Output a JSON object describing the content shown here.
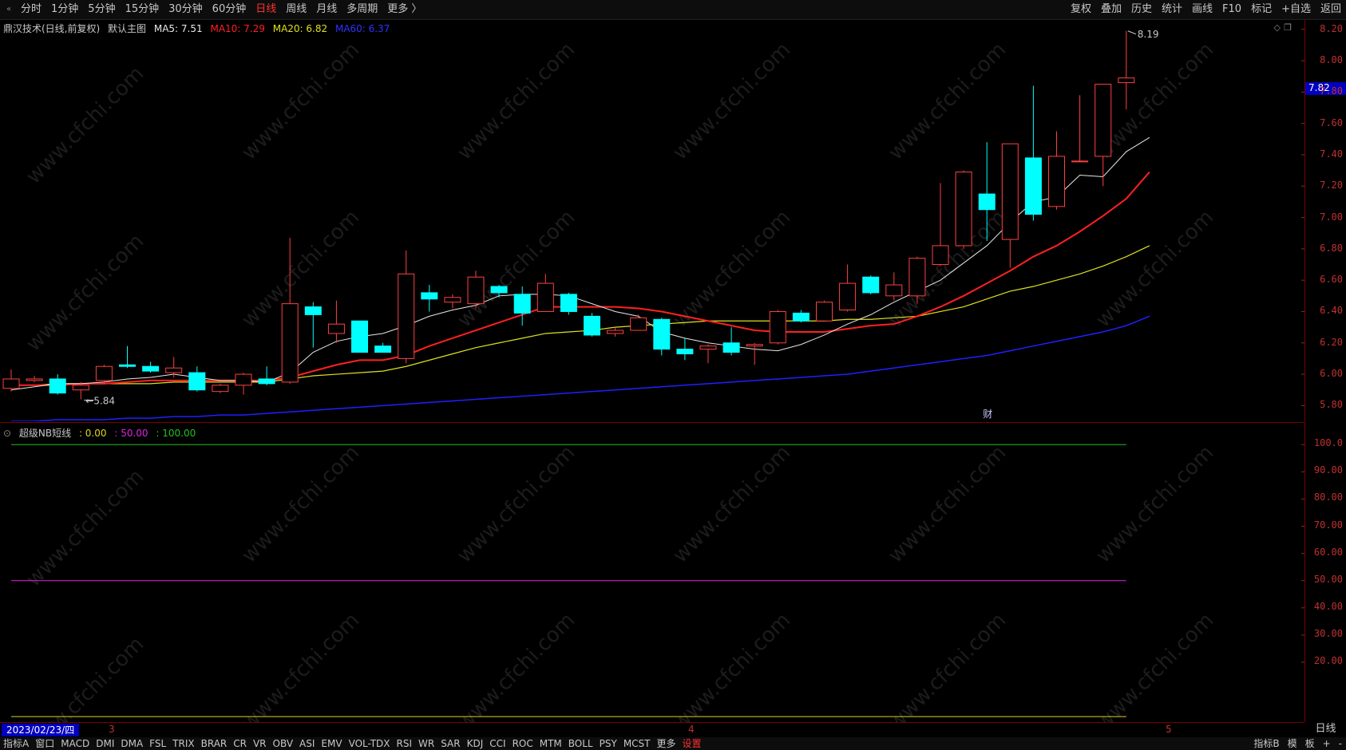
{
  "toolbar": {
    "collapse_glyph": "«",
    "periods": [
      "分时",
      "1分钟",
      "5分钟",
      "15分钟",
      "30分钟",
      "60分钟",
      "日线",
      "周线",
      "月线",
      "多周期",
      "更多 〉"
    ],
    "active_period": "日线",
    "right_buttons": [
      "复权",
      "叠加",
      "历史",
      "统计",
      "画线",
      "F10",
      "标记",
      "+自选",
      "返回"
    ]
  },
  "main_info": {
    "stock": "鼎汉技术(日线,前复权)",
    "template": "默认主图",
    "ma5": "MA5: 7.51",
    "ma10": "MA10: 7.29",
    "ma20": "MA20: 6.82",
    "ma60": "MA60: 6.37"
  },
  "colors": {
    "ma5": "#e8e8e8",
    "ma10": "#ff2020",
    "ma20": "#e0e020",
    "ma60": "#2020ff",
    "up": "#ff4040",
    "down": "#00ffff",
    "ind_green": "#20c020",
    "ind_magenta": "#e020e0",
    "ind_yellow": "#e0d020"
  },
  "price_axis": [
    "8.20",
    "8.00",
    "7.80",
    "7.60",
    "7.40",
    "7.20",
    "7.00",
    "6.80",
    "6.60",
    "6.40",
    "6.20",
    "6.00",
    "5.80"
  ],
  "last_price": "7.82",
  "high_label": "8.19",
  "low_label": "5.84",
  "finance_marker": "财",
  "sub_info": {
    "name": "超级NB短线",
    "v1": ": 0.00",
    "v2": ": 50.00",
    "v3": ": 100.00"
  },
  "sub_axis": [
    "100.0",
    "90.00",
    "80.00",
    "70.00",
    "60.00",
    "50.00",
    "40.00",
    "30.00",
    "20.00"
  ],
  "date_axis": {
    "current": "2023/02/23/四",
    "months": [
      "3",
      "4",
      "5"
    ],
    "period": "日线"
  },
  "bottom": {
    "indicators": [
      "指标A",
      "窗口",
      "MACD",
      "DMI",
      "DMA",
      "FSL",
      "TRIX",
      "BRAR",
      "CR",
      "VR",
      "OBV",
      "ASI",
      "EMV",
      "VOL-TDX",
      "RSI",
      "WR",
      "SAR",
      "KDJ",
      "CCI",
      "ROC",
      "MTM",
      "BOLL",
      "PSY",
      "MCST",
      "更多",
      "设置"
    ],
    "right": [
      "指标B",
      "模",
      "板",
      "+",
      "-"
    ]
  },
  "watermark": "www.cfchi.com",
  "chart_data": {
    "type": "candlestick",
    "candles": [
      {
        "o": 5.91,
        "c": 5.97,
        "h": 6.03,
        "l": 5.89
      },
      {
        "o": 5.96,
        "c": 5.97,
        "h": 5.99,
        "l": 5.95
      },
      {
        "o": 5.97,
        "c": 5.88,
        "h": 6.0,
        "l": 5.87
      },
      {
        "o": 5.9,
        "c": 5.93,
        "h": 5.95,
        "l": 5.84
      },
      {
        "o": 5.96,
        "c": 6.05,
        "h": 6.06,
        "l": 5.94
      },
      {
        "o": 6.06,
        "c": 6.05,
        "h": 6.18,
        "l": 6.04
      },
      {
        "o": 6.05,
        "c": 6.02,
        "h": 6.08,
        "l": 6.01
      },
      {
        "o": 6.01,
        "c": 6.04,
        "h": 6.11,
        "l": 5.98
      },
      {
        "o": 6.01,
        "c": 5.9,
        "h": 6.05,
        "l": 5.89
      },
      {
        "o": 5.89,
        "c": 5.93,
        "h": 5.94,
        "l": 5.88
      },
      {
        "o": 5.93,
        "c": 6.0,
        "h": 6.01,
        "l": 5.87
      },
      {
        "o": 5.97,
        "c": 5.94,
        "h": 6.05,
        "l": 5.93
      },
      {
        "o": 5.95,
        "c": 6.45,
        "h": 6.87,
        "l": 5.94
      },
      {
        "o": 6.43,
        "c": 6.38,
        "h": 6.46,
        "l": 6.17
      },
      {
        "o": 6.26,
        "c": 6.32,
        "h": 6.47,
        "l": 6.2
      },
      {
        "o": 6.34,
        "c": 6.14,
        "h": 6.34,
        "l": 6.14
      },
      {
        "o": 6.18,
        "c": 6.14,
        "h": 6.2,
        "l": 6.14
      },
      {
        "o": 6.1,
        "c": 6.64,
        "h": 6.79,
        "l": 6.07
      },
      {
        "o": 6.52,
        "c": 6.48,
        "h": 6.57,
        "l": 6.4
      },
      {
        "o": 6.46,
        "c": 6.49,
        "h": 6.51,
        "l": 6.42
      },
      {
        "o": 6.45,
        "c": 6.62,
        "h": 6.66,
        "l": 6.42
      },
      {
        "o": 6.56,
        "c": 6.52,
        "h": 6.57,
        "l": 6.49
      },
      {
        "o": 6.51,
        "c": 6.39,
        "h": 6.56,
        "l": 6.31
      },
      {
        "o": 6.4,
        "c": 6.58,
        "h": 6.64,
        "l": 6.4
      },
      {
        "o": 6.51,
        "c": 6.4,
        "h": 6.52,
        "l": 6.38
      },
      {
        "o": 6.37,
        "c": 6.25,
        "h": 6.39,
        "l": 6.24
      },
      {
        "o": 6.26,
        "c": 6.28,
        "h": 6.3,
        "l": 6.24
      },
      {
        "o": 6.28,
        "c": 6.36,
        "h": 6.38,
        "l": 6.28
      },
      {
        "o": 6.35,
        "c": 6.16,
        "h": 6.36,
        "l": 6.12
      },
      {
        "o": 6.16,
        "c": 6.13,
        "h": 6.23,
        "l": 6.09
      },
      {
        "o": 6.16,
        "c": 6.18,
        "h": 6.19,
        "l": 6.07
      },
      {
        "o": 6.2,
        "c": 6.14,
        "h": 6.3,
        "l": 6.12
      },
      {
        "o": 6.18,
        "c": 6.19,
        "h": 6.2,
        "l": 6.06
      },
      {
        "o": 6.2,
        "c": 6.4,
        "h": 6.41,
        "l": 6.19
      },
      {
        "o": 6.39,
        "c": 6.34,
        "h": 6.41,
        "l": 6.33
      },
      {
        "o": 6.34,
        "c": 6.46,
        "h": 6.47,
        "l": 6.34
      },
      {
        "o": 6.41,
        "c": 6.58,
        "h": 6.7,
        "l": 6.4
      },
      {
        "o": 6.62,
        "c": 6.52,
        "h": 6.63,
        "l": 6.51
      },
      {
        "o": 6.5,
        "c": 6.57,
        "h": 6.65,
        "l": 6.47
      },
      {
        "o": 6.5,
        "c": 6.74,
        "h": 6.75,
        "l": 6.45
      },
      {
        "o": 6.7,
        "c": 6.82,
        "h": 7.22,
        "l": 6.69
      },
      {
        "o": 6.82,
        "c": 7.29,
        "h": 7.3,
        "l": 6.8
      },
      {
        "o": 7.15,
        "c": 7.05,
        "h": 7.48,
        "l": 6.85
      },
      {
        "o": 6.86,
        "c": 7.47,
        "h": 7.47,
        "l": 6.68
      },
      {
        "o": 7.38,
        "c": 7.02,
        "h": 7.84,
        "l": 6.98
      },
      {
        "o": 7.07,
        "c": 7.39,
        "h": 7.55,
        "l": 7.05
      },
      {
        "o": 7.36,
        "c": 7.36,
        "h": 7.78,
        "l": 7.36
      },
      {
        "o": 7.39,
        "c": 7.85,
        "h": 7.85,
        "l": 7.2
      },
      {
        "o": 7.86,
        "c": 7.89,
        "h": 8.19,
        "l": 7.69
      }
    ],
    "ma5": [
      5.9,
      5.92,
      5.94,
      5.94,
      5.95,
      5.97,
      5.98,
      6.0,
      5.98,
      5.96,
      5.96,
      5.95,
      6.01,
      6.14,
      6.21,
      6.24,
      6.26,
      6.31,
      6.37,
      6.41,
      6.44,
      6.5,
      6.51,
      6.51,
      6.5,
      6.45,
      6.4,
      6.37,
      6.27,
      6.23,
      6.2,
      6.18,
      6.16,
      6.15,
      6.19,
      6.25,
      6.32,
      6.38,
      6.46,
      6.53,
      6.6,
      6.71,
      6.82,
      6.97,
      7.1,
      7.13,
      7.27,
      7.26,
      7.42,
      7.51
    ],
    "ma10": [
      5.93,
      5.93,
      5.93,
      5.94,
      5.94,
      5.95,
      5.96,
      5.96,
      5.96,
      5.96,
      5.96,
      5.96,
      5.98,
      6.02,
      6.06,
      6.09,
      6.09,
      6.12,
      6.18,
      6.23,
      6.28,
      6.33,
      6.38,
      6.43,
      6.43,
      6.43,
      6.43,
      6.42,
      6.4,
      6.37,
      6.34,
      6.31,
      6.28,
      6.27,
      6.27,
      6.27,
      6.29,
      6.31,
      6.32,
      6.37,
      6.43,
      6.5,
      6.58,
      6.66,
      6.75,
      6.82,
      6.91,
      7.01,
      7.12,
      7.29
    ],
    "ma20": [
      5.93,
      5.93,
      5.94,
      5.94,
      5.94,
      5.94,
      5.94,
      5.95,
      5.95,
      5.95,
      5.95,
      5.95,
      5.97,
      5.99,
      6.0,
      6.01,
      6.02,
      6.05,
      6.09,
      6.13,
      6.17,
      6.2,
      6.23,
      6.26,
      6.27,
      6.28,
      6.3,
      6.31,
      6.32,
      6.33,
      6.34,
      6.34,
      6.34,
      6.34,
      6.34,
      6.34,
      6.35,
      6.35,
      6.36,
      6.37,
      6.4,
      6.43,
      6.48,
      6.53,
      6.56,
      6.6,
      6.64,
      6.69,
      6.75,
      6.82
    ],
    "ma60": [
      5.7,
      5.7,
      5.71,
      5.71,
      5.71,
      5.72,
      5.72,
      5.73,
      5.73,
      5.74,
      5.74,
      5.75,
      5.76,
      5.77,
      5.78,
      5.79,
      5.8,
      5.81,
      5.82,
      5.83,
      5.84,
      5.85,
      5.86,
      5.87,
      5.88,
      5.89,
      5.9,
      5.91,
      5.92,
      5.93,
      5.94,
      5.95,
      5.96,
      5.97,
      5.98,
      5.99,
      6.0,
      6.02,
      6.04,
      6.06,
      6.08,
      6.1,
      6.12,
      6.15,
      6.18,
      6.21,
      6.24,
      6.27,
      6.31,
      6.37
    ],
    "y_range": [
      5.7,
      8.26
    ],
    "indicator": {
      "name": "超级NB短线",
      "lines": [
        {
          "name": "",
          "value": 0.0
        },
        {
          "name": "",
          "value": 50.0
        },
        {
          "name": "",
          "value": 100.0
        }
      ],
      "ylim": [
        -2,
        108
      ]
    }
  }
}
